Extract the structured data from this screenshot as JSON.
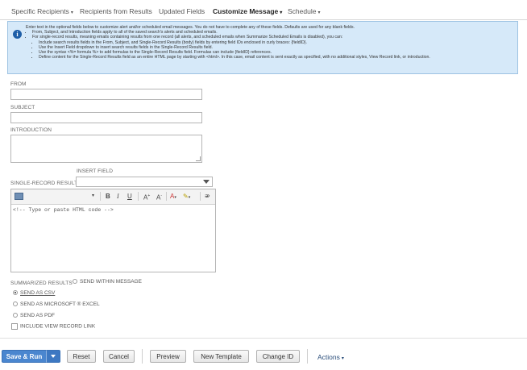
{
  "tabs": [
    {
      "label": "Specific Recipients",
      "underline_index": 1
    },
    {
      "label": "Recipients from Results"
    },
    {
      "label": "Updated Fields"
    },
    {
      "label": "Customize Message"
    },
    {
      "label": "Schedule"
    }
  ],
  "info": {
    "intro": "Enter text in the optional fields below to customize alert and/or scheduled email messages. You do not have to complete any of these fields. Defaults are used for any blank fields.",
    "b1": "From, Subject, and Introduction fields apply to all of the saved search's alerts and scheduled emails.",
    "b2": "For single-record results, meaning emails containing results from one record (all alerts, and scheduled emails when Summarize Scheduled Emails is disabled), you can:",
    "s1": "Include search results fields in the From, Subject, and Single-Record Results (body) fields by entering field IDs enclosed in curly braces: {fieldID}.",
    "s2": "Use the Insert Field dropdown to insert search results fields in the Single-Record Results field.",
    "s3": "Use the syntax <%= formula %> to add formulas to the Single-Record Results field. Formulas can include {fieldID} references.",
    "s4": "Define content for the Single-Record Results field as an entire HTML page by starting with <html>. In this case, email content is sent exactly as specified, with no additional styles, View Record link, or introduction."
  },
  "form": {
    "from_label": "FROM",
    "subject_label": "SUBJECT",
    "intro_label": "INTRODUCTION",
    "insert_field_label": "INSERT FIELD",
    "single_record_label": "SINGLE-RECORD RESULTS",
    "editor_placeholder": "<!-- Type or paste HTML code -->",
    "summarized_label": "SUMMARIZED RESULTS",
    "opt_within": "SEND WITHIN MESSAGE",
    "opt_csv": "SEND AS CSV",
    "opt_excel": "SEND AS MICROSOFT ® EXCEL",
    "opt_pdf": "SEND AS PDF",
    "include_link": "INCLUDE VIEW RECORD LINK"
  },
  "buttons": {
    "save_run": "Save & Run",
    "reset": "Reset",
    "cancel": "Cancel",
    "preview": "Preview",
    "new_template": "New Template",
    "change_id": "Change ID",
    "actions": "Actions"
  },
  "colors": {
    "primary": "#4a86cf",
    "info_bg": "#d6e9f9"
  }
}
